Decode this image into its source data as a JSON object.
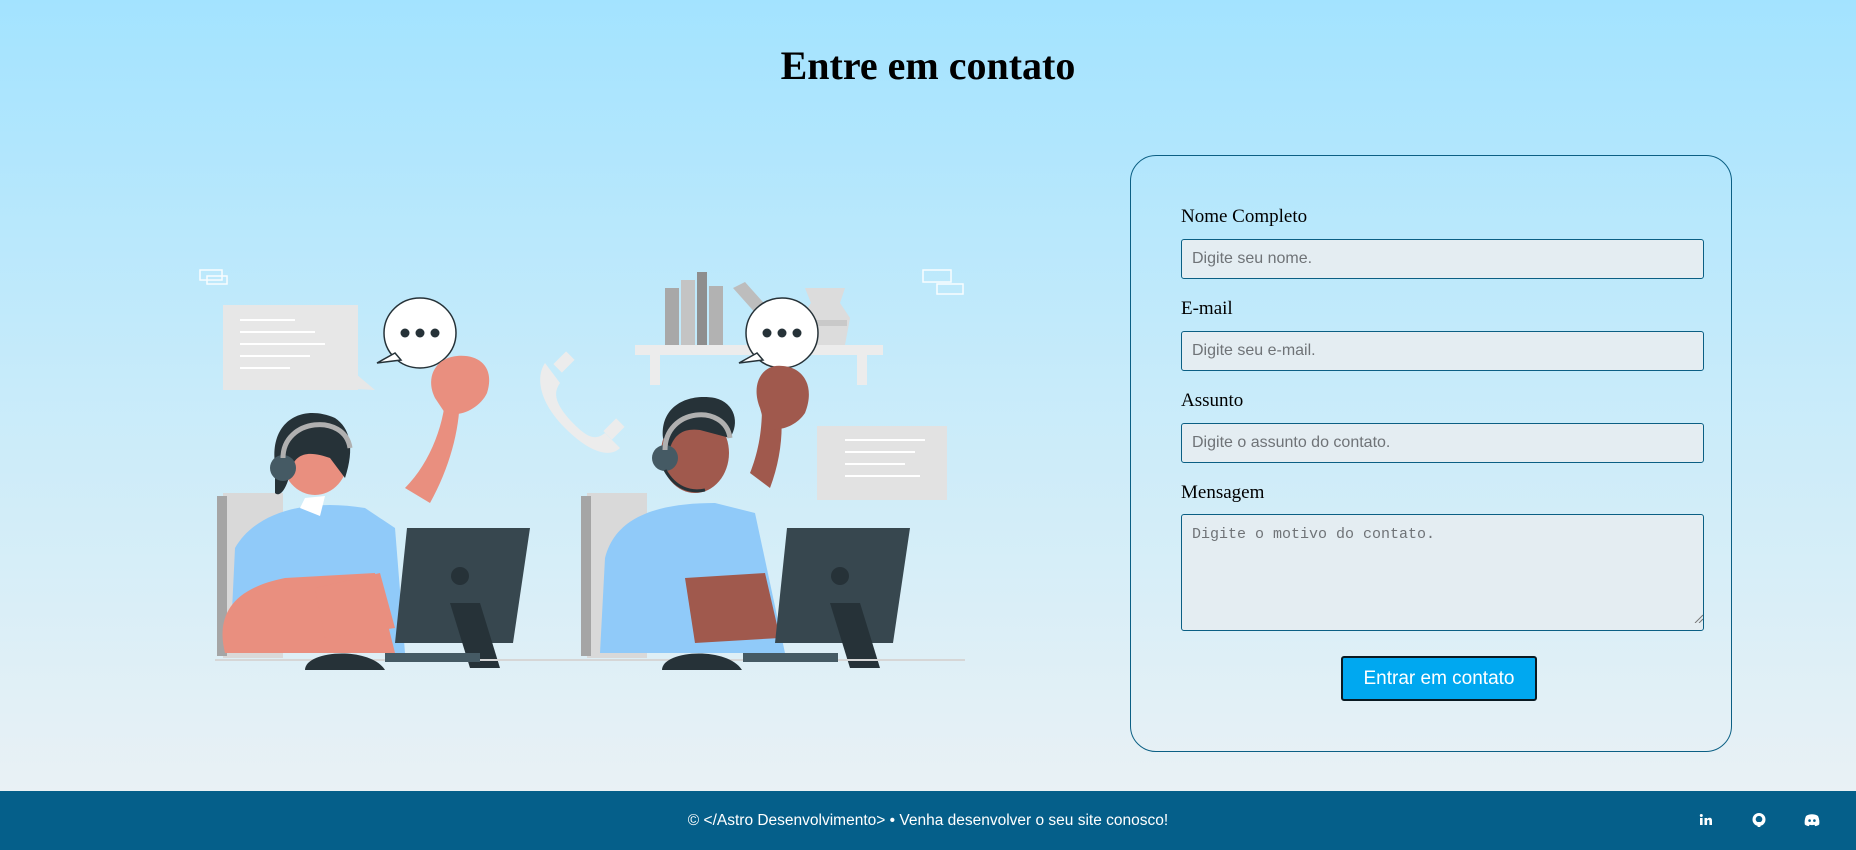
{
  "page": {
    "title": "Entre em contato"
  },
  "colors": {
    "background_top": "#a3e3ff",
    "background_bottom": "#eef2f4",
    "accent": "#00a8f0",
    "border": "#0b5f84",
    "footer": "#055f8a",
    "input_bg": "#e4edf2"
  },
  "illustration": {
    "description_icon": "customer-support-illustration"
  },
  "form": {
    "name_label": "Nome Completo",
    "name_placeholder": "Digite seu nome.",
    "name_value": "",
    "email_label": "E-mail",
    "email_placeholder": "Digite seu e-mail.",
    "email_value": "",
    "subject_label": "Assunto",
    "subject_placeholder": "Digite o assunto do contato.",
    "subject_value": "",
    "message_label": "Mensagem",
    "message_placeholder": "Digite o motivo do contato.",
    "message_value": "",
    "submit_label": "Entrar em contato"
  },
  "footer": {
    "text": "© </Astro Desenvolvimento> • Venha desenvolver o seu site conosco!",
    "social": [
      {
        "icon": "linkedin-icon"
      },
      {
        "icon": "github-icon"
      },
      {
        "icon": "discord-icon"
      }
    ]
  }
}
